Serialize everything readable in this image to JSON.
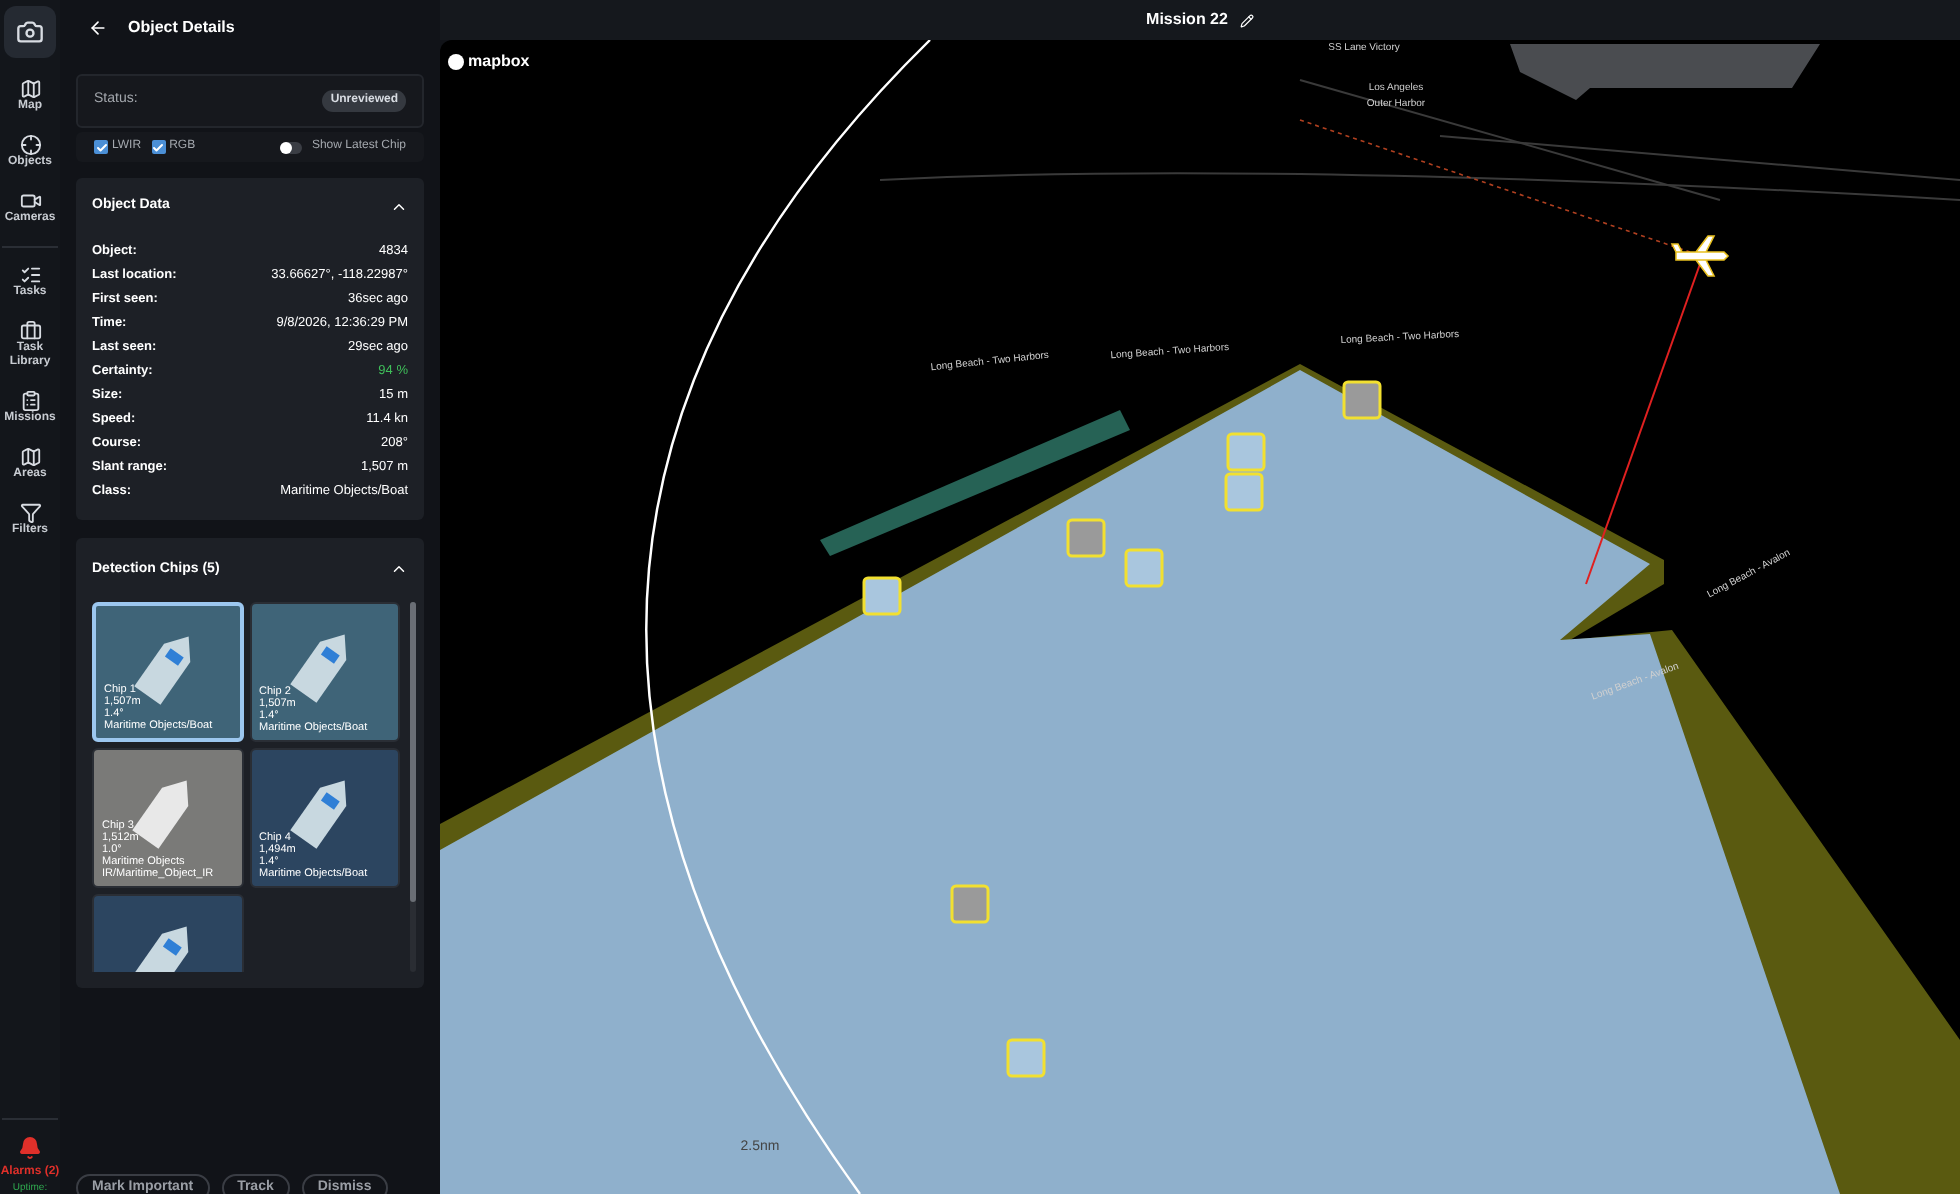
{
  "rail": {
    "items": [
      {
        "kind": "camera",
        "selected": true
      },
      {
        "label": "Map",
        "kind": "map",
        "selected": false
      },
      {
        "label": "Objects",
        "kind": "objects",
        "selected": false
      },
      {
        "label": "Cameras",
        "kind": "cameras",
        "selected": false
      },
      {
        "label": "Tasks",
        "kind": "tasks",
        "selected": false
      },
      {
        "label": "Task Library",
        "kind": "library",
        "selected": false
      },
      {
        "label": "Missions",
        "kind": "missions",
        "selected": false
      },
      {
        "label": "Areas",
        "kind": "areas",
        "selected": false
      },
      {
        "label": "Filters",
        "kind": "filters",
        "selected": false
      }
    ],
    "alarms": "Alarms (2)",
    "uptime": "Uptime:"
  },
  "panel": {
    "title": "Object Details",
    "status_label": "Status:",
    "status": "Unreviewed",
    "checkboxes": [
      {
        "label": "LWIR",
        "checked": true
      },
      {
        "label": "RGB",
        "checked": true
      }
    ],
    "toggle": {
      "label": "Show Latest Chip",
      "on": false
    },
    "object_data": {
      "title": "Object Data",
      "expanded": true,
      "rows": [
        {
          "label": "Object:",
          "value": "4834"
        },
        {
          "label": "Last location:",
          "value": "33.66627°, -118.22987°"
        },
        {
          "label": "First seen:",
          "value": "36sec ago"
        },
        {
          "label": "Time:",
          "value": "9/8/2026, 12:36:29 PM"
        },
        {
          "label": "Last seen:",
          "value": "29sec ago"
        },
        {
          "label": "Certainty:",
          "value": "94 %",
          "kind": "good"
        },
        {
          "label": "Size:",
          "value": "15 m"
        },
        {
          "label": "Speed:",
          "value": "11.4 kn"
        },
        {
          "label": "Course:",
          "value": "208°"
        },
        {
          "label": "Slant range:",
          "value": "1,507 m"
        },
        {
          "label": "Class:",
          "value": "Maritime Objects/Boat"
        }
      ]
    },
    "chips": {
      "title": "Detection Chips (5)",
      "expanded": true,
      "items": [
        {
          "kind": "rgb",
          "selected": true,
          "lines": [
            "Chip 1",
            "1,507m",
            "1.4°",
            "Maritime Objects/Boat"
          ]
        },
        {
          "kind": "rgb",
          "selected": false,
          "lines": [
            "Chip 2",
            "1,507m",
            "1.4°",
            "Maritime Objects/Boat"
          ]
        },
        {
          "kind": "ir",
          "selected": false,
          "lines": [
            "Chip 3",
            "1,512m",
            "1.0°",
            "Maritime Objects",
            "IR/Maritime_Object_IR"
          ]
        },
        {
          "kind": "edge",
          "selected": false,
          "lines": [
            "Chip 4",
            "1,494m",
            "1.4°",
            "Maritime Objects/Boat"
          ]
        },
        {
          "kind": "edge",
          "selected": false
        }
      ]
    },
    "actions": [
      "Mark Important",
      "Track",
      "Dismiss"
    ]
  },
  "header": {
    "title": "Mission 22"
  },
  "map": {
    "logo": "mapbox",
    "labels": [
      "SS Lane Victory",
      "Los Angeles",
      "Outer Harbor",
      "Long Beach - Two Harbors",
      "Long Beach - Two Harbors",
      "Long Beach - Two Harbors",
      "Long Beach - Avalon",
      "Long Beach - Avalon"
    ],
    "scale": "2.5nm"
  }
}
